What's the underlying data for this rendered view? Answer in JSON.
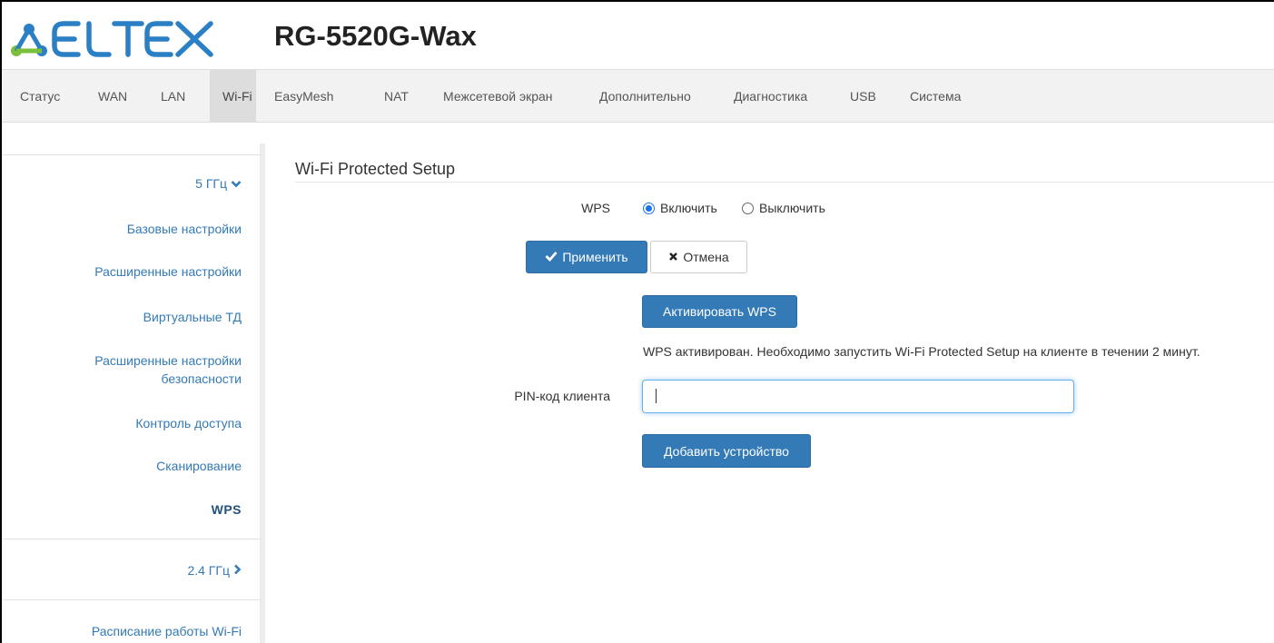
{
  "header": {
    "logo_text": "ELTEX",
    "device_title": "RG-5520G-Wax"
  },
  "nav": {
    "items": [
      "Статус",
      "WAN",
      "LAN",
      "Wi-Fi",
      "EasyMesh",
      "NAT",
      "Межсетевой экран",
      "Дополнительно",
      "Диагностика",
      "USB",
      "Система"
    ],
    "active": "Wi-Fi"
  },
  "sidebar": {
    "group_5ghz": "5 ГГц",
    "items_5ghz": [
      "Базовые настройки",
      "Расширенные настройки",
      "Виртуальные ТД",
      "Расширенные настройки",
      "безопасности",
      "Контроль доступа",
      "Сканирование",
      "WPS"
    ],
    "active_item": "WPS",
    "group_24ghz": "2.4 ГГц",
    "schedule": "Расписание работы Wi-Fi"
  },
  "main": {
    "section_title": "Wi-Fi Protected Setup",
    "wps_label": "WPS",
    "radio_enable": "Включить",
    "radio_disable": "Выключить",
    "wps_selected": "Включить",
    "apply_button": "Применить",
    "cancel_button": "Отмена",
    "activate_button": "Активировать WPS",
    "status_text": "WPS активирован. Необходимо запустить Wi-Fi Protected Setup на клиенте в течении 2 минут.",
    "pin_label": "PIN-код клиента",
    "pin_value": "",
    "add_device_button": "Добавить устройство"
  },
  "colors": {
    "brand_primary": "#337ab7",
    "logo_blue": "#2b7fc4",
    "logo_green": "#7bbf3a",
    "nav_bg": "#f2f2f2",
    "nav_active_bg": "#dddddd"
  }
}
